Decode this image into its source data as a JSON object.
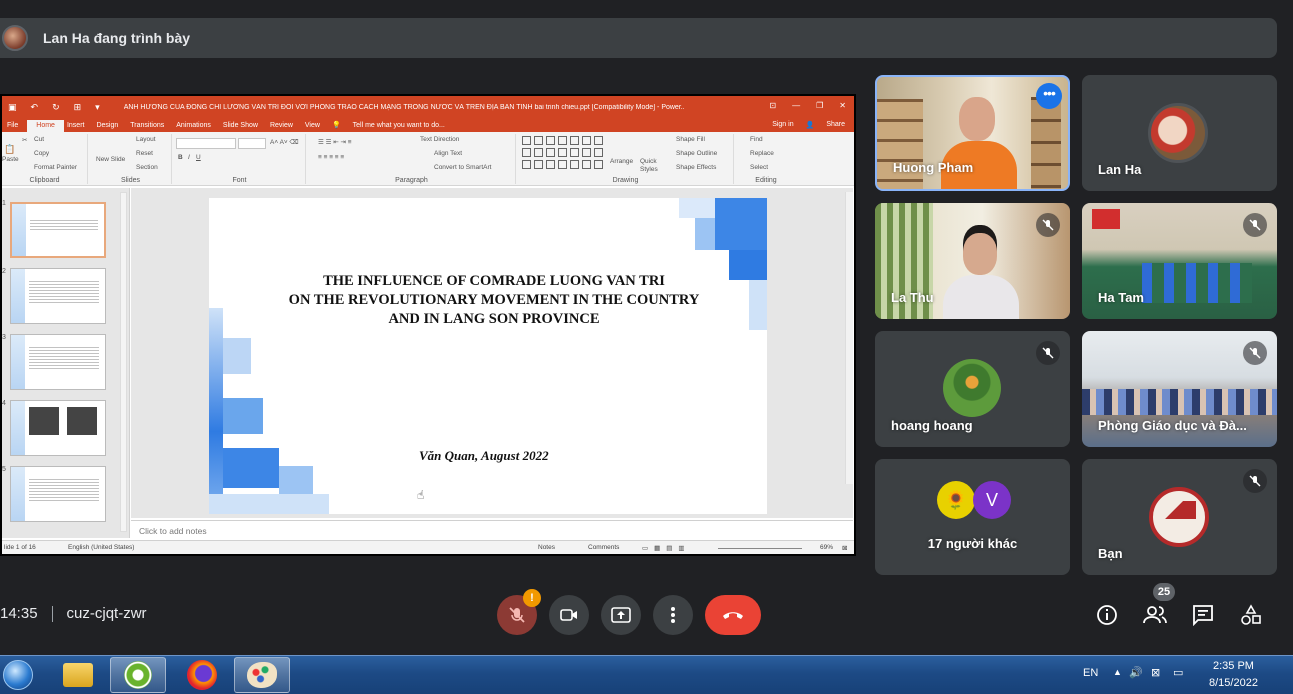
{
  "presenter_banner": {
    "text": "Lan Ha đang trình bày"
  },
  "ppt": {
    "doc_title": "ẢNH HƯỞNG CỦA ĐỒNG CHÍ LƯƠNG VĂN TRI ĐỐI VỚI PHONG TRÀO CÁCH MẠNG TRONG NƯỚC VÀ TRÊN ĐỊA BÀN TỈNH bai trinh chieu.ppt [Compatibility Mode] - Power...",
    "tabs": [
      "File",
      "Home",
      "Insert",
      "Design",
      "Transitions",
      "Animations",
      "Slide Show",
      "Review",
      "View"
    ],
    "tell_me": "Tell me what you want to do...",
    "sign_in": "Sign in",
    "share": "Share",
    "ribbon": {
      "paste": "Paste",
      "cut": "Cut",
      "copy": "Copy",
      "format_painter": "Format Painter",
      "clipboard": "Clipboard",
      "new_slide": "New Slide",
      "layout": "Layout",
      "reset": "Reset",
      "section": "Section",
      "slides": "Slides",
      "font": "Font",
      "text_direction": "Text Direction",
      "align_text": "Align Text",
      "convert_smartart": "Convert to SmartArt",
      "paragraph": "Paragraph",
      "arrange": "Arrange",
      "quick_styles": "Quick Styles",
      "shape_fill": "Shape Fill",
      "shape_outline": "Shape Outline",
      "shape_effects": "Shape Effects",
      "drawing": "Drawing",
      "find": "Find",
      "replace": "Replace",
      "select": "Select",
      "editing": "Editing"
    },
    "thumb_numbers": [
      "1",
      "2",
      "3",
      "4",
      "5"
    ],
    "slide": {
      "title_lines": [
        "THE INFLUENCE OF COMRADE LUONG VAN TRI",
        "ON THE REVOLUTIONARY MOVEMENT IN THE COUNTRY",
        "AND IN LANG SON PROVINCE"
      ],
      "date": "Văn Quan, August 2022"
    },
    "notes_placeholder": "Click to add notes",
    "status": {
      "slide_of": "lide 1 of 16",
      "language": "English (United States)",
      "notes": "Notes",
      "comments": "Comments",
      "zoom": "69%"
    }
  },
  "participants": [
    {
      "name": "Huong Pham",
      "muted": false,
      "active": true
    },
    {
      "name": "Lan Ha",
      "muted": false
    },
    {
      "name": "La Thu",
      "muted": true
    },
    {
      "name": "Ha Tam",
      "muted": true
    },
    {
      "name": "hoang hoang",
      "muted": true
    },
    {
      "name": "Phòng Giáo dục và Đà...",
      "muted": true
    },
    {
      "name": "17 người khác",
      "avatar_letter": "V"
    },
    {
      "name": "Bạn",
      "muted": true
    }
  ],
  "meeting": {
    "time": "14:35",
    "code": "cuz-cjqt-zwr",
    "mic_warning": "!",
    "people_count": "25"
  },
  "taskbar": {
    "language": "EN",
    "time": "2:35 PM",
    "date": "8/15/2022"
  },
  "colors": {
    "meet_bg": "#202124",
    "tile_bg": "#3c4043",
    "end_call": "#ea4335",
    "ppt_accent": "#d04423",
    "active_border": "#8ab4f8"
  }
}
